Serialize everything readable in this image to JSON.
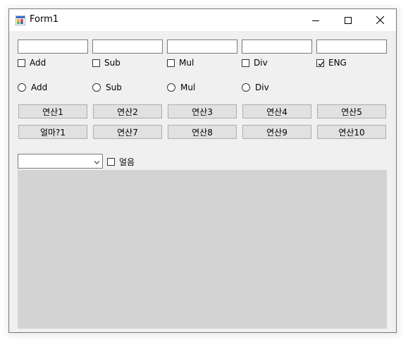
{
  "window": {
    "title": "Form1",
    "icon": "form-app-icon",
    "controls": {
      "minimize": "minimize-icon",
      "maximize": "maximize-icon",
      "close": "close-icon"
    }
  },
  "textboxes": [
    "",
    "",
    "",
    "",
    ""
  ],
  "checkboxes": [
    {
      "label": "Add",
      "checked": false
    },
    {
      "label": "Sub",
      "checked": false
    },
    {
      "label": "Mul",
      "checked": false
    },
    {
      "label": "Div",
      "checked": false
    },
    {
      "label": "ENG",
      "checked": true
    }
  ],
  "radios": [
    {
      "label": "Add",
      "selected": false
    },
    {
      "label": "Sub",
      "selected": false
    },
    {
      "label": "Mul",
      "selected": false
    },
    {
      "label": "Div",
      "selected": false
    }
  ],
  "buttons_row1": [
    "연산1",
    "연산2",
    "연산3",
    "연산4",
    "연산5"
  ],
  "buttons_row2": [
    "얼마?1",
    "연산7",
    "연산8",
    "연산9",
    "연산10"
  ],
  "combo": {
    "value": ""
  },
  "freeze_checkbox": {
    "label": "얼음",
    "checked": false
  },
  "colors": {
    "panel": "#d3d3d3",
    "form_bg": "#f0f0f0",
    "button_bg": "#e1e1e1"
  }
}
